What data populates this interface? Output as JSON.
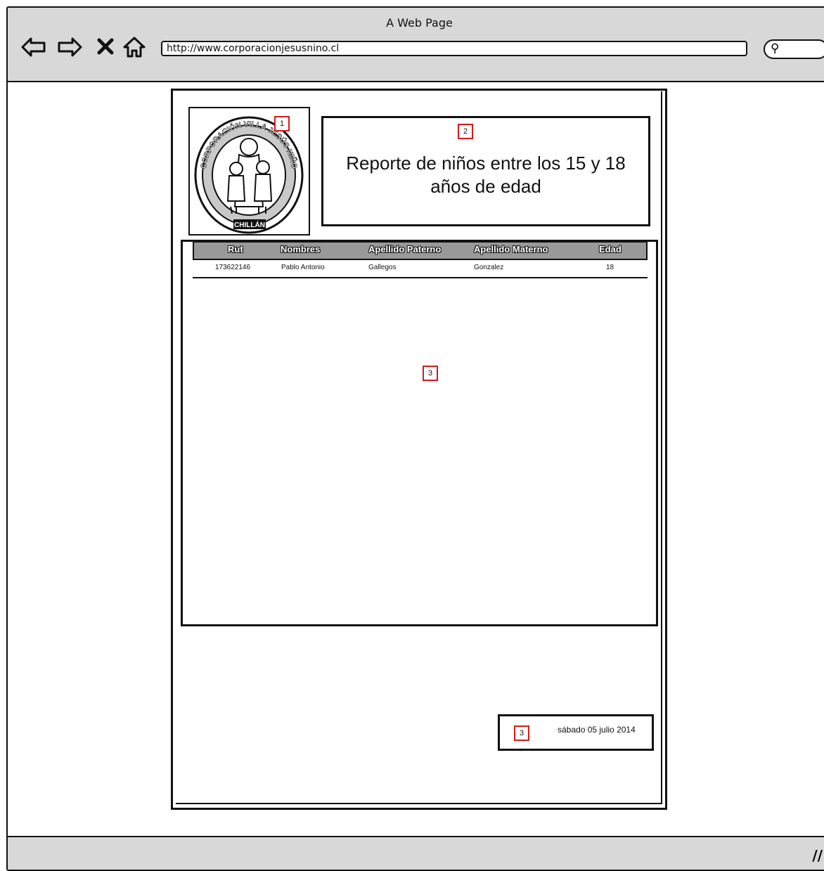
{
  "browser": {
    "window_title": "A Web Page",
    "url": "http://www.corporacionjesusnino.cl",
    "icons": [
      "back-arrow-icon",
      "forward-arrow-icon",
      "close-x-icon",
      "home-icon",
      "search-icon"
    ]
  },
  "logo": {
    "top_text": "CORPORACIÓN VILLA JESÚS NIÑO",
    "bottom_text": "CHILLÁN",
    "marker": "1"
  },
  "title": {
    "marker": "2",
    "text": "Reporte de niños entre los 15 y 18 años de edad"
  },
  "table": {
    "marker": "3",
    "headers": [
      "Rut",
      "Nombres",
      "Apellido Paterno",
      "Apellido Materno",
      "Edad"
    ],
    "rows": [
      [
        "173622146",
        "Pablo Antonio",
        "Gallegos",
        "Gonzalez",
        "18"
      ]
    ]
  },
  "footer": {
    "marker": "3",
    "date": "sábado 05 julio 2014"
  }
}
